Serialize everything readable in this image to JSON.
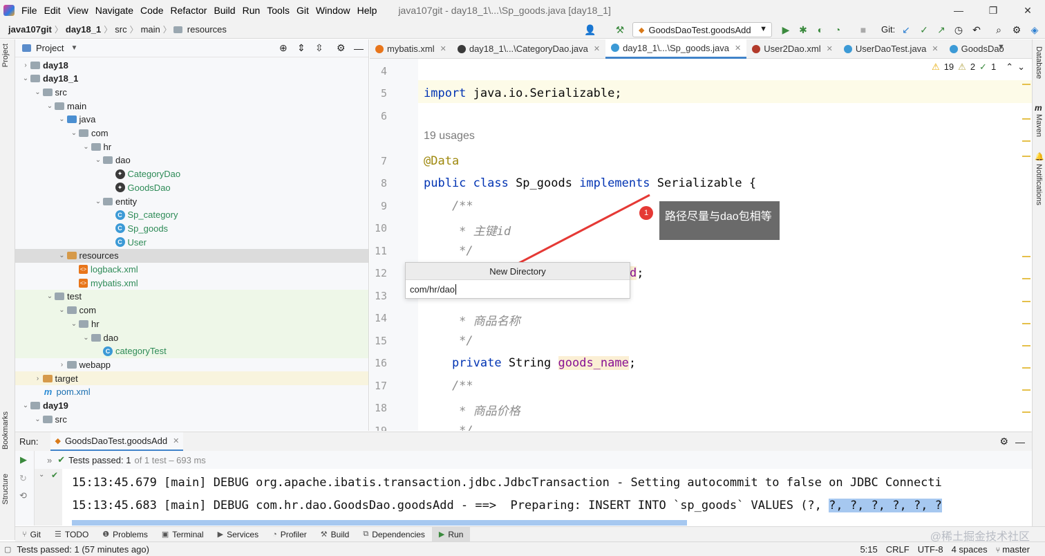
{
  "window": {
    "menus": [
      "File",
      "Edit",
      "View",
      "Navigate",
      "Code",
      "Refactor",
      "Build",
      "Run",
      "Tools",
      "Git",
      "Window",
      "Help"
    ],
    "title": "java107git - day18_1\\...\\Sp_goods.java [day18_1]",
    "controls": [
      "—",
      "❐",
      "✕"
    ]
  },
  "navbar": {
    "breadcrumbs": [
      "java107git",
      "day18_1",
      "src",
      "main",
      "resources"
    ],
    "run_config": "GoodsDaoTest.goodsAdd",
    "git_label": "Git:"
  },
  "project": {
    "title": "Project",
    "tree": [
      {
        "label": "day18",
        "depth": 1,
        "icon": "folder",
        "arrow": "▶",
        "bold": true
      },
      {
        "label": "day18_1",
        "depth": 1,
        "icon": "folder",
        "arrow": "▼",
        "bold": true
      },
      {
        "label": "src",
        "depth": 2,
        "icon": "folder",
        "arrow": "▼"
      },
      {
        "label": "main",
        "depth": 3,
        "icon": "folder",
        "arrow": "▼"
      },
      {
        "label": "java",
        "depth": 4,
        "icon": "folder-blue",
        "arrow": "▼"
      },
      {
        "label": "com",
        "depth": 5,
        "icon": "folder",
        "arrow": "▼"
      },
      {
        "label": "hr",
        "depth": 6,
        "icon": "folder",
        "arrow": "▼"
      },
      {
        "label": "dao",
        "depth": 7,
        "icon": "folder",
        "arrow": "▼"
      },
      {
        "label": "CategoryDao",
        "depth": 8,
        "icon": "mybatis",
        "arrow": "",
        "color": "green"
      },
      {
        "label": "GoodsDao",
        "depth": 8,
        "icon": "mybatis",
        "arrow": "",
        "color": "green"
      },
      {
        "label": "entity",
        "depth": 7,
        "icon": "folder",
        "arrow": "▼"
      },
      {
        "label": "Sp_category",
        "depth": 8,
        "icon": "class",
        "arrow": "",
        "color": "green"
      },
      {
        "label": "Sp_goods",
        "depth": 8,
        "icon": "class",
        "arrow": "",
        "color": "green"
      },
      {
        "label": "User",
        "depth": 8,
        "icon": "class",
        "arrow": "",
        "color": "green"
      },
      {
        "label": "resources",
        "depth": 4,
        "icon": "folder-orange",
        "arrow": "▼",
        "highlight": "selected"
      },
      {
        "label": "logback.xml",
        "depth": 5,
        "icon": "xml",
        "arrow": "",
        "color": "green"
      },
      {
        "label": "mybatis.xml",
        "depth": 5,
        "icon": "xml",
        "arrow": "",
        "color": "green"
      },
      {
        "label": "test",
        "depth": 3,
        "icon": "folder",
        "arrow": "▼",
        "highlight": "green"
      },
      {
        "label": "com",
        "depth": 4,
        "icon": "folder",
        "arrow": "▼",
        "highlight": "green"
      },
      {
        "label": "hr",
        "depth": 5,
        "icon": "folder",
        "arrow": "▼",
        "highlight": "green"
      },
      {
        "label": "dao",
        "depth": 6,
        "icon": "folder",
        "arrow": "▼",
        "highlight": "green"
      },
      {
        "label": "categoryTest",
        "depth": 7,
        "icon": "class",
        "arrow": "",
        "color": "green",
        "highlight": "green"
      },
      {
        "label": "webapp",
        "depth": 4,
        "icon": "folder",
        "arrow": "▶"
      },
      {
        "label": "target",
        "depth": 2,
        "icon": "folder-orange",
        "arrow": "▶",
        "highlight": "yellow"
      },
      {
        "label": "pom.xml",
        "depth": 2,
        "icon": "maven",
        "arrow": "",
        "color": "blue"
      },
      {
        "label": "day19",
        "depth": 1,
        "icon": "folder",
        "arrow": "▼",
        "bold": true
      },
      {
        "label": "src",
        "depth": 2,
        "icon": "folder",
        "arrow": "▼"
      }
    ]
  },
  "tabs": [
    {
      "label": "mybatis.xml",
      "icon_color": "#e8751a"
    },
    {
      "label": "day18_1\\...\\CategoryDao.java",
      "icon_color": "#3a3a3a"
    },
    {
      "label": "day18_1\\...\\Sp_goods.java",
      "icon_color": "#3c9ad6",
      "active": true
    },
    {
      "label": "User2Dao.xml",
      "icon_color": "#b23a2a"
    },
    {
      "label": "UserDaoTest.java",
      "icon_color": "#3c9ad6"
    },
    {
      "label": "GoodsDao",
      "icon_color": "#3c9ad6"
    }
  ],
  "editor": {
    "inspections": {
      "warnings": "19",
      "weak": "2",
      "ok": "1"
    },
    "usages": "19 usages",
    "lines": [
      {
        "n": "4",
        "text": ""
      },
      {
        "n": "5",
        "text": "import java.io.Serializable;"
      },
      {
        "n": "6",
        "text": ""
      },
      {
        "n": "7",
        "text": "@Data"
      },
      {
        "n": "8",
        "text": "public class Sp_goods implements Serializable {"
      },
      {
        "n": "9",
        "text": "    /**"
      },
      {
        "n": "10",
        "text": "     * 主键id"
      },
      {
        "n": "11",
        "text": "     */"
      },
      {
        "n": "12",
        "text": "d;"
      },
      {
        "n": "13",
        "text": ""
      },
      {
        "n": "14",
        "text": "     * 商品名称"
      },
      {
        "n": "15",
        "text": "     */"
      },
      {
        "n": "16",
        "text": "    private String goods_name;"
      },
      {
        "n": "17",
        "text": "    /**"
      },
      {
        "n": "18",
        "text": "     * 商品价格"
      },
      {
        "n": "19",
        "text": "     */"
      }
    ]
  },
  "new_directory": {
    "title": "New Directory",
    "value": "com/hr/dao"
  },
  "annotation": {
    "badge": "1",
    "text": "路径尽量与dao包相等"
  },
  "run": {
    "label": "Run:",
    "tab": "GoodsDaoTest.goodsAdd",
    "tests_passed": "Tests passed: 1",
    "tests_detail": "of 1 test – 693 ms",
    "console": [
      "15:13:45.679 [main] DEBUG org.apache.ibatis.transaction.jdbc.JdbcTransaction - Setting autocommit to false on JDBC Connecti",
      "15:13:45.683 [main] DEBUG com.hr.dao.GoodsDao.goodsAdd - ==>  Preparing: INSERT INTO `sp_goods` VALUES (?, ?, ?, ?, ?, ?, ?"
    ]
  },
  "bottom_tabs": [
    "Git",
    "TODO",
    "Problems",
    "Terminal",
    "Services",
    "Profiler",
    "Build",
    "Dependencies",
    "Run"
  ],
  "status": {
    "left": "Tests passed: 1 (57 minutes ago)",
    "position": "5:15",
    "line_sep": "CRLF",
    "encoding": "UTF-8",
    "indent": "4 spaces",
    "branch": "master"
  },
  "side_tabs": {
    "left": [
      "Project",
      "Bookmarks",
      "Structure"
    ],
    "right": [
      "Database",
      "Maven",
      "Notifications"
    ]
  },
  "watermark": "@稀土掘金技术社区"
}
